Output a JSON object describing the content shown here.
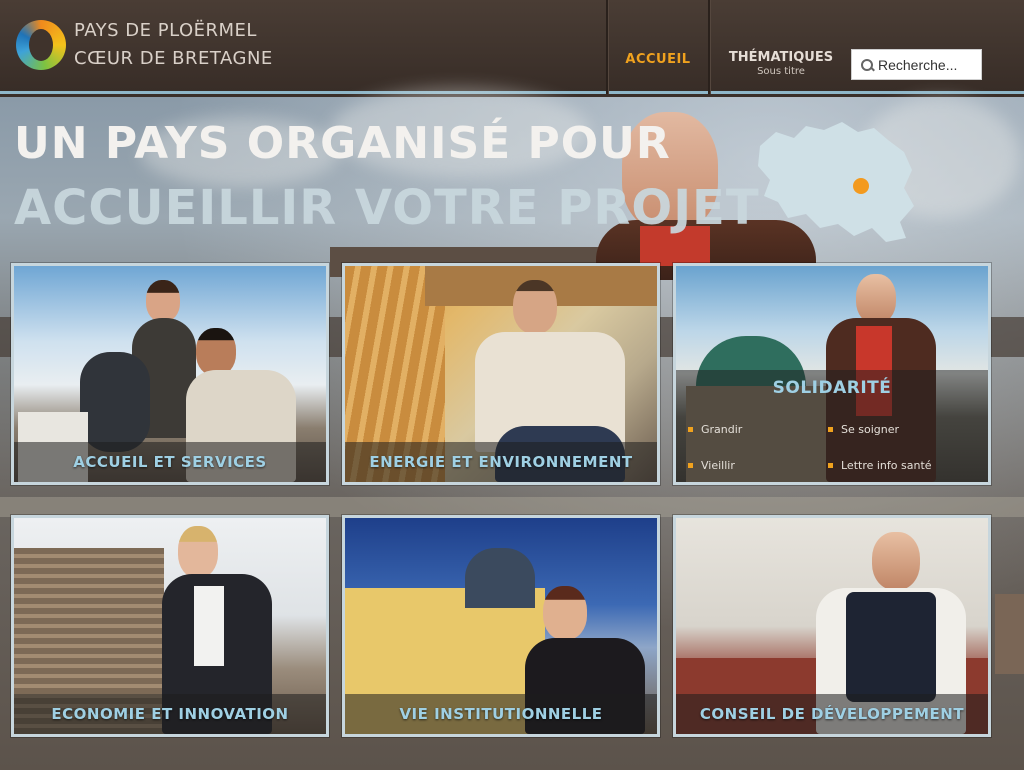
{
  "header": {
    "brand_line1": "PAYS DE PLOËRMEL",
    "brand_line2": "CŒUR DE BRETAGNE",
    "logo_icon": "ring-logo-icon",
    "nav": {
      "accueil": "ACCUEIL",
      "thematiques": "THÉMATIQUES",
      "thematiques_sub": "Sous titre"
    },
    "search": {
      "placeholder": "Recherche...",
      "icon": "search-icon"
    }
  },
  "hero": {
    "headline_line1": "UN PAYS ORGANISÉ POUR",
    "headline_line2": "ACCUEILLIR VOTRE PROJET"
  },
  "tiles": [
    {
      "label": "ACCUEIL ET SERVICES"
    },
    {
      "label": "ENERGIE ET ENVIRONNEMENT"
    },
    {
      "label": "SOLIDARITÉ",
      "links": [
        "Grandir",
        "Se soigner",
        "Vieillir",
        "Lettre info santé"
      ]
    },
    {
      "label": "ECONOMIE ET INNOVATION"
    },
    {
      "label": "VIE INSTITUTIONNELLE"
    },
    {
      "label": "CONSEIL DE DÉVELOPPEMENT"
    }
  ],
  "colors": {
    "accent": "#f0a21e",
    "tile_label": "#9fd0e4",
    "header_bg": "#3f332c",
    "tile_border": "#c7d6dd"
  }
}
